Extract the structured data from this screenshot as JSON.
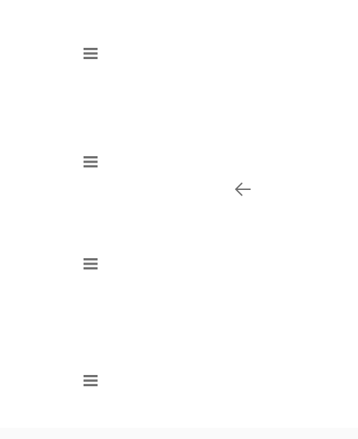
{
  "colors": {
    "background": "#ffffff",
    "icon": "#6f6f6f",
    "bottom_band": "#fafafa"
  },
  "icons": {
    "menu": "hamburger-menu-icon",
    "back": "arrow-left-icon"
  },
  "menu_buttons": [
    {
      "icon": "menu-icon"
    },
    {
      "icon": "menu-icon"
    },
    {
      "icon": "menu-icon"
    },
    {
      "icon": "menu-icon"
    }
  ],
  "back_button": {
    "icon": "arrow-left-icon"
  }
}
